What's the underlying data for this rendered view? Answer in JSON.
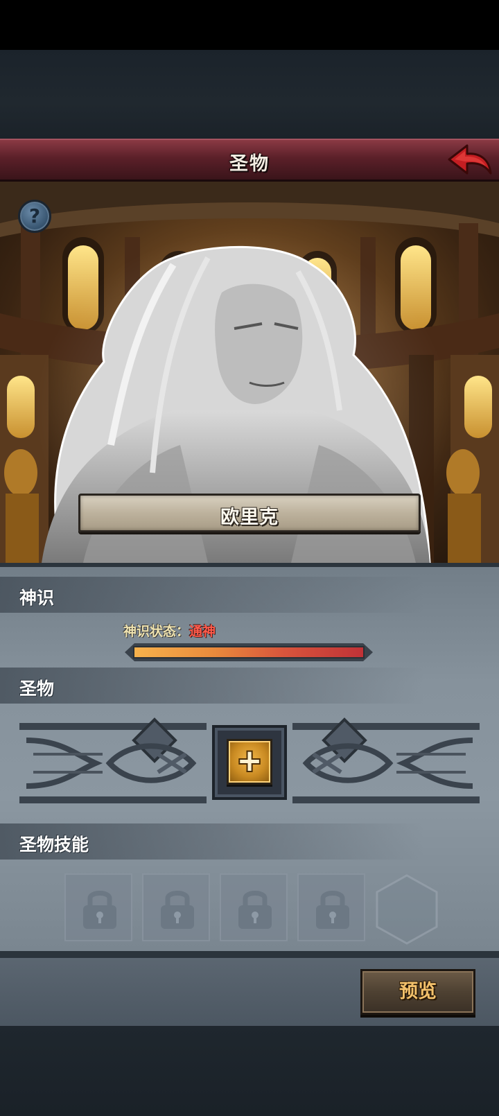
{
  "header": {
    "title": "圣物",
    "back_icon": "back-arrow-icon",
    "help_icon": "question-mark-icon",
    "help_glyph": "?"
  },
  "hero": {
    "name": "欧里克"
  },
  "divine_sense": {
    "section_label": "神识",
    "state_label": "神识状态：",
    "state_value": "通神",
    "progress": 1.0
  },
  "relic": {
    "section_label": "圣物",
    "add_glyph": "+",
    "add_icon": "plus-icon"
  },
  "relic_skills": {
    "section_label": "圣物技能",
    "locked_slots": 4,
    "lock_icon": "padlock-icon",
    "empty_icon": "hexagon-slot-icon"
  },
  "footer": {
    "preview_label": "预览"
  },
  "colors": {
    "title_bar": "#5b2029",
    "state_value": "#ff5a4a",
    "progress_start": "#f7b24c",
    "progress_end": "#c03237",
    "preview_text": "#f3c16b"
  }
}
